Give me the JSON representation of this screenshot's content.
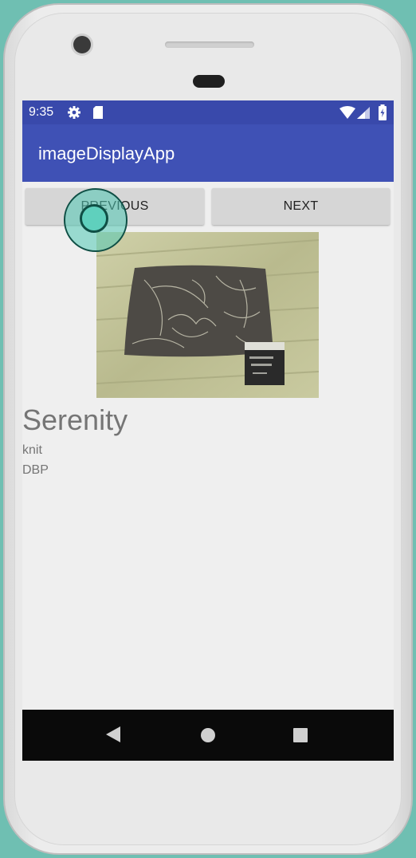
{
  "status_bar": {
    "time": "9:35",
    "icons": [
      "gear-icon",
      "sd-card-icon",
      "wifi-icon",
      "cell-signal-icon",
      "battery-icon"
    ]
  },
  "app_bar": {
    "title": "imageDisplayApp"
  },
  "buttons": {
    "previous_label": "PREVIOUS",
    "next_label": "NEXT"
  },
  "item": {
    "image_description": "photo of dark fabric with light line-art floral print on a wood floor, with a label tag",
    "name": "Serenity",
    "type": "knit",
    "brand": "DBP"
  },
  "nav_bar": {
    "icons": [
      "back-icon",
      "home-icon",
      "recents-icon"
    ]
  },
  "colors": {
    "status_bar": "#3949ab",
    "app_bar": "#3f51b5",
    "screen_background": "#efefef",
    "button": "#d6d6d6",
    "touch_indicator": "#5fd0bd"
  }
}
